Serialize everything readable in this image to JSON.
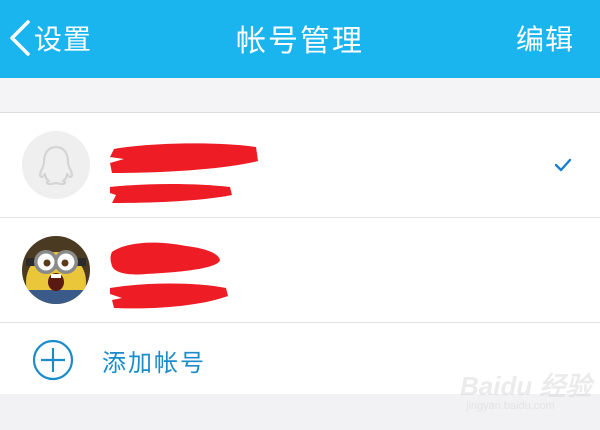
{
  "nav": {
    "back_label": "设置",
    "title": "帐号管理",
    "edit_label": "编辑"
  },
  "accounts": [
    {
      "avatar": "default-qq-avatar",
      "name": "",
      "id": "",
      "selected": true
    },
    {
      "avatar": "minion-avatar",
      "name": "",
      "id": "",
      "selected": false
    }
  ],
  "add_account": {
    "label": "添加帐号",
    "icon": "plus-circle-icon"
  },
  "watermark": {
    "brand": "Baidu 经验",
    "url": "jingyan.baidu.com"
  },
  "colors": {
    "nav_bg": "#1ab4ee",
    "accent": "#1a8ccc",
    "redaction": "#ee1c25"
  }
}
